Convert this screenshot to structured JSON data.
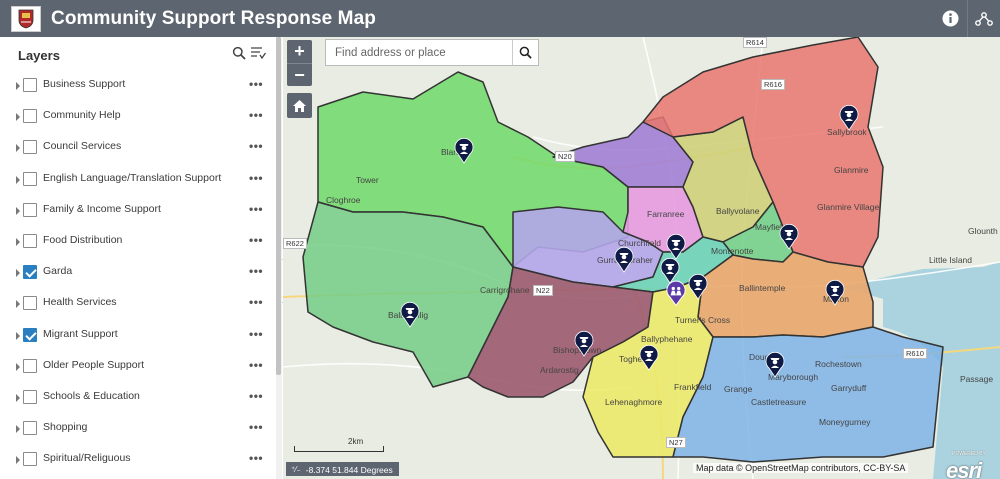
{
  "header": {
    "title": "Community Support Response Map",
    "bg_color": "#5d6570",
    "icons": [
      "info-icon",
      "share-icon"
    ]
  },
  "sidebar": {
    "title": "Layers",
    "tools": [
      "search-icon",
      "filter-icon"
    ],
    "layers": [
      {
        "label": "Business Support",
        "checked": false
      },
      {
        "label": "Community Help",
        "checked": false
      },
      {
        "label": "Council Services",
        "checked": false
      },
      {
        "label": "English Language/Translation Support",
        "checked": false
      },
      {
        "label": "Family & Income Support",
        "checked": false
      },
      {
        "label": "Food Distribution",
        "checked": false
      },
      {
        "label": "Garda",
        "checked": true
      },
      {
        "label": "Health Services",
        "checked": false
      },
      {
        "label": "Migrant Support",
        "checked": true
      },
      {
        "label": "Older People Support",
        "checked": false
      },
      {
        "label": "Schools & Education",
        "checked": false
      },
      {
        "label": "Shopping",
        "checked": false
      },
      {
        "label": "Spiritual/Religuous",
        "checked": false
      }
    ],
    "more_label": "•••"
  },
  "map": {
    "search_placeholder": "Find address or place",
    "zoom_in": "+",
    "zoom_out": "−",
    "scale_label": "2km",
    "coordinates": "-8.374 51.844 Degrees",
    "attribution": "Map data © OpenStreetMap contributors, CC-BY-SA",
    "esri_label": "esri",
    "esri_powered": "POWERED BY",
    "place_labels": {
      "blarney": "Blarney",
      "tower": "Tower",
      "cloghroe": "Cloghroe",
      "ballincollig": "Ballincollig",
      "carrigrohane": "Carrigrohane",
      "bishopstown": "Bishopstown",
      "ardarostig": "Ardarostig",
      "togher": "Togher",
      "ballyphehane": "Ballyphehane",
      "turners_cross": "Turner's Cross",
      "frankfield": "Frankfield",
      "grange": "Grange",
      "lehenaghmore": "Lehenaghmore",
      "douglas": "Douglas",
      "maryborough": "Maryborough",
      "rochestown": "Rochestown",
      "castletreasure": "Castletreasure",
      "garryduff": "Garryduff",
      "moneygurney": "Moneygurney",
      "ballintemple": "Ballintemple",
      "mahon": "Mahon",
      "montenotte": "Montenotte",
      "mayfield": "Mayfield",
      "ballyvolane": "Ballyvolane",
      "farranree": "Farranree",
      "churchfield": "Churchfield",
      "gurranabraher": "Gurranabraher",
      "glanmire": "Glanmire",
      "glanmire_village": "Glanmire Village",
      "sallybrook": "Sallybrook",
      "little_island": "Little Island",
      "passage": "Passage",
      "glounthaune": "Glounth"
    },
    "road_labels": {
      "r614": "R614",
      "r616": "R616",
      "n20": "N20",
      "r622": "R622",
      "n22": "N22",
      "n27": "N27",
      "r610": "R610"
    },
    "zone_colors": {
      "green": "#6fd96a",
      "light_green": "#74cc86",
      "red": "#e8776e",
      "purple": "#a27fd6",
      "lavender": "#b3a6ea",
      "pink": "#e59be0",
      "maroon": "#9c5a70",
      "yellow": "#ecea6a",
      "blue": "#7fb4e6",
      "orange": "#e9a76d",
      "teal": "#6bd3b8",
      "olive": "#cfd07a"
    },
    "marker_color": "#0f1a45",
    "marker_icon": "police-officer-icon",
    "migrant_marker_icon": "people-group-icon"
  }
}
